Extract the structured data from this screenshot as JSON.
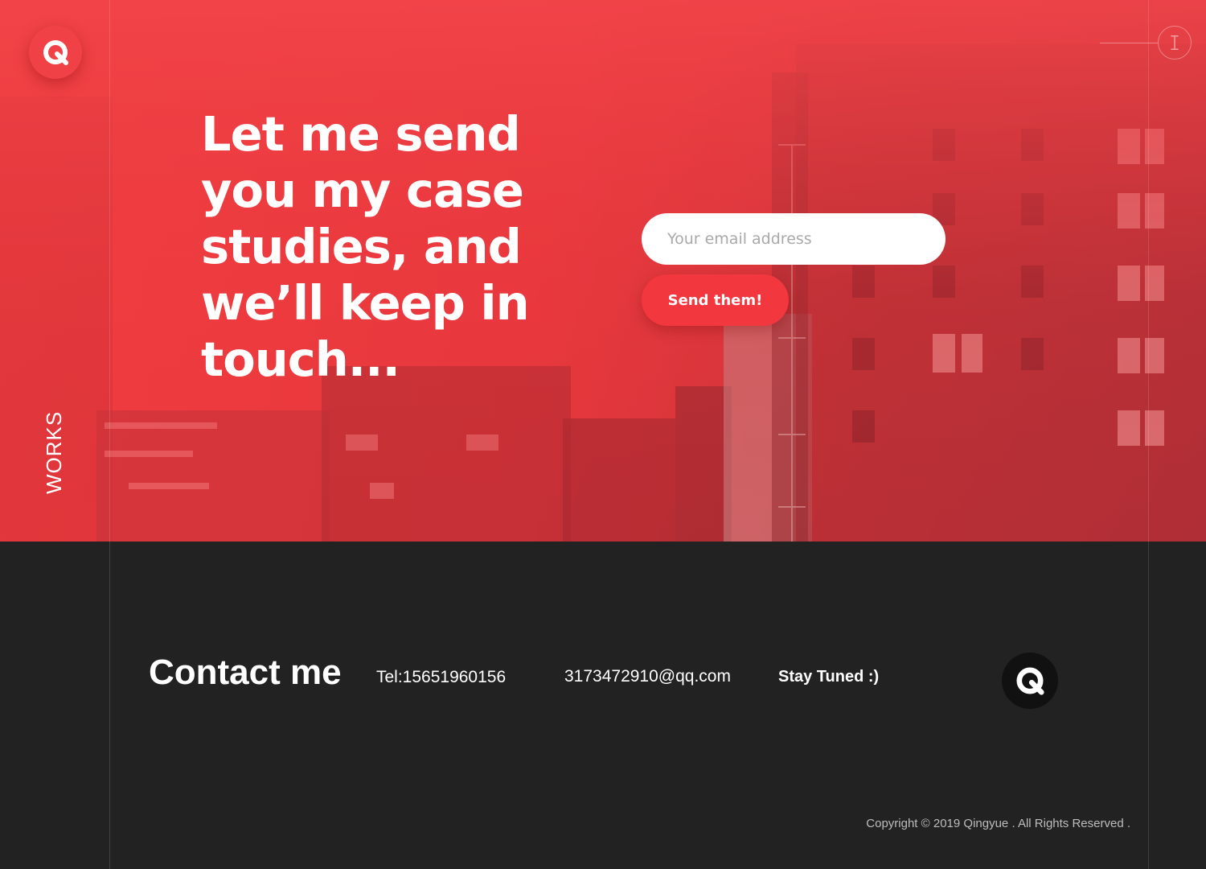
{
  "hero": {
    "headline": "Let me send you my case studies, and we’ll keep in touch...",
    "side_label": "WORKS",
    "email_placeholder": "Your email address",
    "send_label": "Send them!"
  },
  "footer": {
    "contact_title": "Contact me",
    "tel": "Tel:15651960156",
    "email": "3173472910@qq.com",
    "stay_tuned": "Stay Tuned :)",
    "copyright": "Copyright © 2019 Qingyue . All Rights Reserved ."
  },
  "icons": {
    "top_logo": "q-logo-icon",
    "bottom_logo": "q-logo-icon",
    "corner": "cursor-icon"
  },
  "colors": {
    "accent": "#f2373e",
    "footer_bg": "#222222"
  }
}
